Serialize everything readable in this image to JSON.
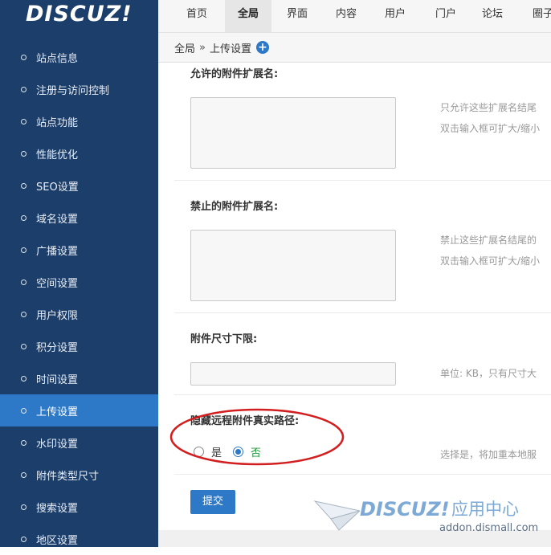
{
  "logo": {
    "text": "DISCUZ!"
  },
  "nav": {
    "tabs": [
      {
        "label": "首页",
        "active": false
      },
      {
        "label": "全局",
        "active": true
      },
      {
        "label": "界面",
        "active": false
      },
      {
        "label": "内容",
        "active": false
      },
      {
        "label": "用户",
        "active": false
      },
      {
        "label": "门户",
        "active": false
      },
      {
        "label": "论坛",
        "active": false
      },
      {
        "label": "圈子",
        "active": false
      }
    ]
  },
  "breadcrumb": {
    "root": "全局",
    "sep": "»",
    "current": "上传设置"
  },
  "sidebar": {
    "items": [
      {
        "label": "站点信息",
        "active": false
      },
      {
        "label": "注册与访问控制",
        "active": false
      },
      {
        "label": "站点功能",
        "active": false
      },
      {
        "label": "性能优化",
        "active": false
      },
      {
        "label": "SEO设置",
        "active": false
      },
      {
        "label": "域名设置",
        "active": false
      },
      {
        "label": "广播设置",
        "active": false
      },
      {
        "label": "空间设置",
        "active": false
      },
      {
        "label": "用户权限",
        "active": false
      },
      {
        "label": "积分设置",
        "active": false
      },
      {
        "label": "时间设置",
        "active": false
      },
      {
        "label": "上传设置",
        "active": true
      },
      {
        "label": "水印设置",
        "active": false
      },
      {
        "label": "附件类型尺寸",
        "active": false
      },
      {
        "label": "搜索设置",
        "active": false
      },
      {
        "label": "地区设置",
        "active": false
      }
    ]
  },
  "form": {
    "allowed_ext": {
      "label": "允许的附件扩展名:",
      "value": "",
      "hint1": "只允许这些扩展名结尾",
      "hint2": "双击输入框可扩大/缩小"
    },
    "forbidden_ext": {
      "label": "禁止的附件扩展名:",
      "value": "",
      "hint1": "禁止这些扩展名结尾的",
      "hint2": "双击输入框可扩大/缩小"
    },
    "min_size": {
      "label": "附件尺寸下限:",
      "value": "",
      "hint": "单位: KB，只有尺寸大"
    },
    "hide_remote_path": {
      "label": "隐藏远程附件真实路径:",
      "option_yes": "是",
      "option_no": "否",
      "selected": "否",
      "hint": "选择是，将加重本地服"
    },
    "submit_label": "提交"
  },
  "watermark": {
    "brand": "DISCUZ!",
    "suffix": "应用中心",
    "url": "addon.dismall.com"
  },
  "colors": {
    "sidebar_bg": "#1c3e6a",
    "accent": "#2d79c7",
    "annotation_red": "#d21e1e",
    "option_selected_text": "#1e9a3a"
  }
}
